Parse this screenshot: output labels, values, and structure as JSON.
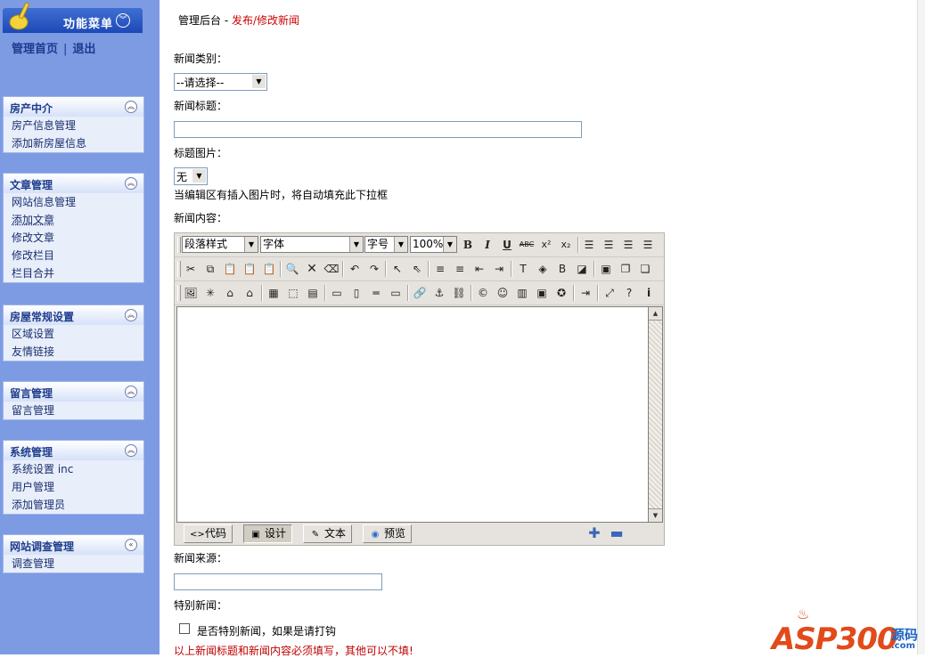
{
  "sidebar": {
    "menu_title": "功能菜单",
    "home_link": "管理首页",
    "separator": "|",
    "logout_link": "退出",
    "groups": [
      {
        "title": "房产中介",
        "items": [
          "房产信息管理",
          "添加新房屋信息"
        ]
      },
      {
        "title": "文章管理",
        "items": [
          "网站信息管理",
          "添加文章",
          "修改文章",
          "修改栏目",
          "栏目合并"
        ]
      },
      {
        "title": "房屋常规设置",
        "items": [
          "区域设置",
          "友情链接"
        ]
      },
      {
        "title": "留言管理",
        "items": [
          "留言管理"
        ]
      },
      {
        "title": "系统管理",
        "items": [
          "系统设置 inc",
          "用户管理",
          "添加管理员"
        ]
      },
      {
        "title": "网站调查管理",
        "items": [
          "调查管理"
        ]
      }
    ]
  },
  "breadcrumb": {
    "root": "管理后台",
    "sep": " - ",
    "current": "发布/修改新闻"
  },
  "form": {
    "category_label": "新闻类别：",
    "category_value": "--请选择--",
    "title_label": "新闻标题：",
    "title_value": "",
    "image_label": "标题图片：",
    "image_value": "无",
    "image_hint": "当编辑区有插入图片时，将自动填充此下拉框",
    "content_label": "新闻内容：",
    "source_label": "新闻来源：",
    "source_value": "",
    "special_label": "特别新闻：",
    "special_checkbox_label": "是否特别新闻，如果是请打钩",
    "required_note": "以上新闻标题和新闻内容必须填写，其他可以不填!"
  },
  "editor": {
    "paragraph_style": "段落样式",
    "font": "字体",
    "font_size": "字号",
    "zoom": "100%",
    "modes": [
      "代码",
      "设计",
      "文本",
      "预览"
    ],
    "active_mode": "设计"
  },
  "logo": {
    "main": "ASP300",
    "cn": "源码",
    "suffix": ".com"
  },
  "colors": {
    "sidebar_bg": "#7d9be3",
    "menu_head": "#1d49b7",
    "red_text": "#c00000",
    "editor_bg": "#e6e3de"
  }
}
